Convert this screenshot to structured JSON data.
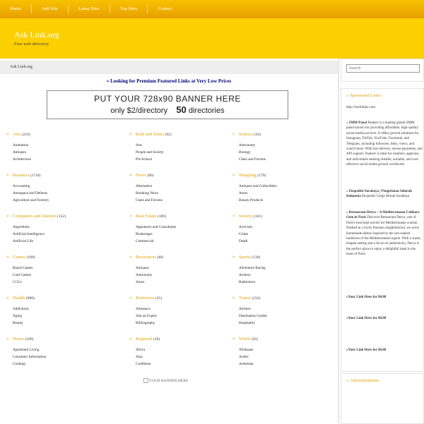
{
  "nav": [
    "Home",
    "Add Site",
    "Latest Sites",
    "Top Sites",
    "Contact"
  ],
  "header": {
    "title": "Ask Link.org",
    "tagline": "Free web directory"
  },
  "breadcrumb": "Ask Link.org",
  "search": {
    "placeholder": "Search"
  },
  "promo": "» Looking for Premium Featured Links at Very Low Prices",
  "banner": {
    "line1": "PUT YOUR 728x90 BANNER HERE",
    "line2a": "only $2/directory",
    "line2b": "50",
    "line2c": "directories"
  },
  "bottom_banner": "YOUR BANNER HERE",
  "categories": [
    {
      "name": "Arts",
      "count": "(219)",
      "subs": [
        "Animation",
        "Antiques",
        "Architecture"
      ]
    },
    {
      "name": "Kids and Teens",
      "count": "(92)",
      "subs": [
        "Arts",
        "People and Society",
        "Pre-School"
      ]
    },
    {
      "name": "Science",
      "count": "(50)",
      "subs": [
        "Astronomy",
        "Biology",
        "Chats and Forums"
      ]
    },
    {
      "name": "Business",
      "count": "(1718)",
      "subs": [
        "Accounting",
        "Aerospace and Defense",
        "Agriculture and Forestry"
      ]
    },
    {
      "name": "News",
      "count": "(86)",
      "subs": [
        "Alternative",
        "Breaking News",
        "Chats and Forums"
      ]
    },
    {
      "name": "Shopping",
      "count": "(176)",
      "subs": [
        "Antiques and Collectibles",
        "Autos",
        "Beauty Products"
      ]
    },
    {
      "name": "Computers and Internet",
      "count": "(152)",
      "subs": [
        "Algorithms",
        "Artificial Intelligence",
        "Artificial Life"
      ]
    },
    {
      "name": "Real Estate",
      "count": "(189)",
      "subs": [
        "Appraisers and Consultants",
        "Brokerages",
        "Commercial"
      ]
    },
    {
      "name": "Society",
      "count": "(101)",
      "subs": [
        "Activism",
        "Crime",
        "Death"
      ]
    },
    {
      "name": "Games",
      "count": "(108)",
      "subs": [
        "Board Games",
        "Card Games",
        "CCGs"
      ]
    },
    {
      "name": "Recreation",
      "count": "(48)",
      "subs": [
        "Antiques",
        "Astronomy",
        "Autos"
      ]
    },
    {
      "name": "Sports",
      "count": "(130)",
      "subs": [
        "Adventure Racing",
        "Archery",
        "Badminton"
      ]
    },
    {
      "name": "Health",
      "count": "(988)",
      "subs": [
        "Addictions",
        "Aging",
        "Beauty"
      ]
    },
    {
      "name": "Reference",
      "count": "(25)",
      "subs": [
        "Almanacs",
        "Ask an Expert",
        "Bibliography"
      ]
    },
    {
      "name": "Travel",
      "count": "(233)",
      "subs": [
        "Airlines",
        "Destination Guides",
        "Hospitality"
      ]
    },
    {
      "name": "Home",
      "count": "(106)",
      "subs": [
        "Apartment Living",
        "Consumer Information",
        "Cooking"
      ]
    },
    {
      "name": "Regional",
      "count": "(16)",
      "subs": [
        "Africa",
        "Asia",
        "Caribbean"
      ]
    },
    {
      "name": "World",
      "count": "(56)",
      "subs": [
        "Afrikaans",
        "Arabic",
        "Armenian"
      ]
    }
  ],
  "sidebar": {
    "sponsored_heading": "Sponsored Links",
    "backlinks": "http://backlinks.com",
    "ads": [
      {
        "title": "SMM Panel",
        "text": "Peakerr is a leading global SMM panel known for providing affordable, high-quality social media services. It offers growth solutions for Instagram, TikTok, YouTube, Facebook, and Telegram, including followers, likes, views, and watch hours. With fast delivery, secure payments, and API support, Peakerr is ideal for resellers, agencies, and individuals seeking reliable, scalable, and cost-effective social media growth worldwide."
      },
      {
        "title": "Ekspedisi Surabaya | Pengiriman Seluruh Indonesia",
        "text": "Ekspedisi Cargo Murah Surabaya"
      },
      {
        "title": "Restaurant Derya – A Mediterranean Culinary Gem in Paris",
        "text": "Discover Restaurant Derya, one of Paris's best-kept secrets for Mediterranean cuisine. Nestled in a lively Parisian neighborhood, we serve homemade dishes inspired by the sun-soaked traditions of the Mediterranean region. With a warm, elegant setting and a focus on authenticity, Derya is the perfect place to enjoy a delightful meal in the heart of Paris."
      }
    ],
    "your_link": [
      "»Your Link Here for $0.80",
      "»Your Link Here for $0.80",
      "»Your Link Here for $0.80"
    ],
    "ads_heading": "Advertisements"
  }
}
